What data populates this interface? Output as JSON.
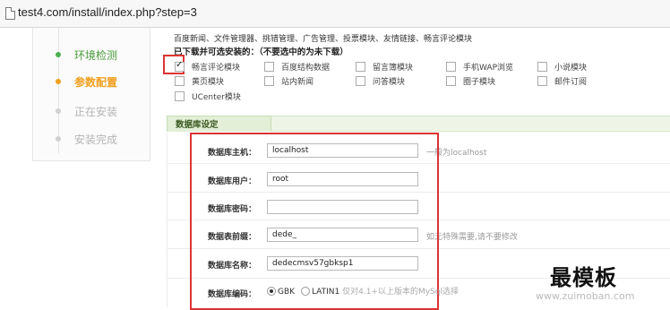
{
  "browser": {
    "url": "test4.com/install/index.php?step=3"
  },
  "steps": [
    {
      "label": "环境检测",
      "state": "done"
    },
    {
      "label": "参数配置",
      "state": "active"
    },
    {
      "label": "正在安装",
      "state": "pending"
    },
    {
      "label": "安装完成",
      "state": "pending"
    }
  ],
  "modules": {
    "top_links": "百度新闻、文件管理器、挑错管理、广告管理、投票模块、友情链接、畅言评论模块",
    "title": "已下载并可选安装的：（不要选中的为未下载）",
    "items": [
      {
        "label": "畅言评论模块",
        "checked": true
      },
      {
        "label": "百度结构数据",
        "checked": false
      },
      {
        "label": "留言簿模块",
        "checked": false
      },
      {
        "label": "手机WAP浏览",
        "checked": false
      },
      {
        "label": "小说模块",
        "checked": false
      },
      {
        "label": "黄页模块",
        "checked": false
      },
      {
        "label": "站内新闻",
        "checked": false
      },
      {
        "label": "问答模块",
        "checked": false
      },
      {
        "label": "圈子模块",
        "checked": false
      },
      {
        "label": "邮件订阅",
        "checked": false
      },
      {
        "label": "UCenter模块",
        "checked": false
      }
    ]
  },
  "db": {
    "section_title": "数据库设定",
    "fields": [
      {
        "label": "数据库主机：",
        "value": "localhost",
        "hint": "一般为localhost"
      },
      {
        "label": "数据库用户：",
        "value": "root",
        "hint": ""
      },
      {
        "label": "数据库密码：",
        "value": "",
        "hint": ""
      },
      {
        "label": "数据表前缀：",
        "value": "dede_",
        "hint": "如无特殊需要,请不要修改"
      },
      {
        "label": "数据库名称：",
        "value": "dedecmsv57gbksp1",
        "hint": ""
      }
    ],
    "encoding": {
      "label": "数据库编码：",
      "options": [
        {
          "label": "GBK",
          "selected": true
        },
        {
          "label": "LATIN1",
          "selected": false
        }
      ],
      "hint": "仅对4.1+以上版本的MySql选择"
    }
  },
  "watermark": {
    "title": "最模板",
    "url": "www.zuimoban.com"
  },
  "colors": {
    "highlight": "#dd3333",
    "done": "#4a9c3c",
    "active": "#f0a020"
  }
}
